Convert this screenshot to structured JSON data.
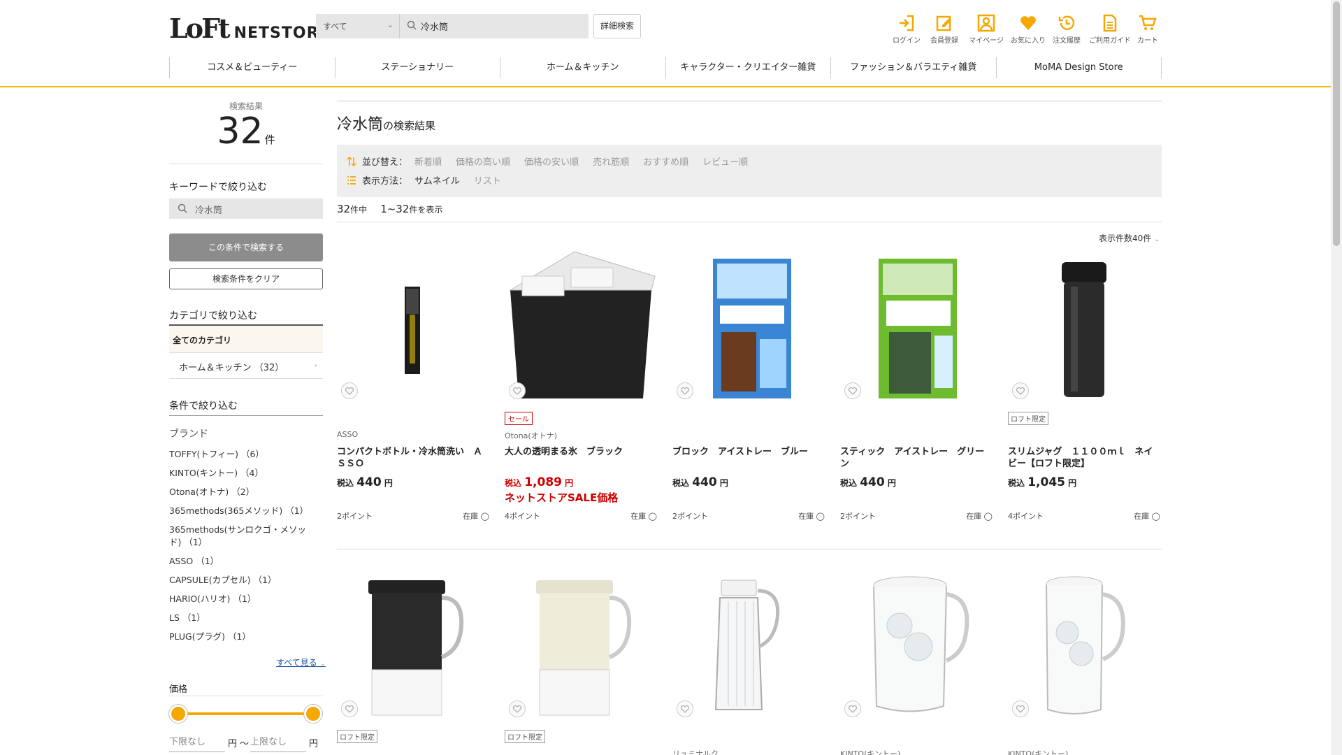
{
  "header": {
    "logo_main": "LoFt",
    "logo_sub": "NETSTORE",
    "search_scope": "すべて",
    "search_value": "冷水筒",
    "advanced_search": "詳細検索",
    "icons": [
      {
        "name": "login-icon",
        "label": "ログイン"
      },
      {
        "name": "register-icon",
        "label": "会員登録"
      },
      {
        "name": "mypage-icon",
        "label": "マイページ"
      },
      {
        "name": "favorite-icon",
        "label": "お気に入り"
      },
      {
        "name": "history-icon",
        "label": "注文履歴"
      },
      {
        "name": "guide-icon",
        "label": "ご利用ガイド"
      },
      {
        "name": "cart-icon",
        "label": "カート"
      }
    ],
    "accent_color": "#f5b800"
  },
  "nav": [
    "コスメ＆ビューティー",
    "ステーショナリー",
    "ホーム＆キッチン",
    "キャラクター・クリエイター雑貨",
    "ファッション＆バラエティ雑貨",
    "MoMA Design Store"
  ],
  "sidebar": {
    "results_label": "検索結果",
    "results_count": "32",
    "results_unit": "件",
    "keyword_title": "キーワードで絞り込む",
    "keyword_value": "冷水筒",
    "search_button": "この条件で検索する",
    "clear_button": "検索条件をクリア",
    "category_title": "カテゴリで絞り込む",
    "category_all": "全てのカテゴリ",
    "category_home": "ホーム＆キッチン （32）",
    "conditions_title": "条件で絞り込む",
    "brand_title": "ブランド",
    "brands": [
      "TOFFY(トフィー) （6）",
      "KINTO(キントー) （4）",
      "Otona(オトナ) （2）",
      "365methods(365メソッド) （1）",
      "365methods(サンロクゴ・メソッド) （1）",
      "ASSO （1）",
      "CAPSULE(カプセル) （1）",
      "HARIO(ハリオ) （1）",
      "LS （1）",
      "PLUG(プラグ) （1）"
    ],
    "see_all": "すべて見る",
    "price_title": "価格",
    "price_min_placeholder": "下限なし",
    "price_max_placeholder": "上限なし",
    "price_unit_from": "円 〜",
    "price_unit_to": "円"
  },
  "main": {
    "query": "冷水筒",
    "query_suffix": "の検索結果",
    "sort_label": "並び替え：",
    "sort_options": [
      "新着順",
      "価格の高い順",
      "価格の安い順",
      "売れ筋順",
      "おすすめ順",
      "レビュー順"
    ],
    "view_label": "表示方法：",
    "view_options": [
      "サムネイル",
      "リスト"
    ],
    "total": "32",
    "total_suffix": "件中",
    "range": "1~32",
    "range_suffix": "件を表示",
    "per_page": "表示件数40件"
  },
  "products": [
    {
      "brand": "ASSO",
      "name": "コンパクトボトル・冷水筒洗い　ＡＳＳＯ",
      "price_prefix": "税込",
      "price": "440",
      "price_unit": "円",
      "points": "2ポイント",
      "stock": "在庫 ◯"
    },
    {
      "badge": "セール",
      "brand": "Otona(オトナ)",
      "name": "大人の透明まる氷　ブラック",
      "price_prefix": "税込",
      "price": "1,089",
      "price_unit": "円",
      "sale_label": "ネットストアSALE価格",
      "points": "4ポイント",
      "stock": "在庫 ◯"
    },
    {
      "brand": "",
      "name": "ブロック　アイストレー　ブルー",
      "price_prefix": "税込",
      "price": "440",
      "price_unit": "円",
      "points": "2ポイント",
      "stock": "在庫 ◯"
    },
    {
      "brand": "",
      "name": "スティック　アイストレー　グリーン",
      "price_prefix": "税込",
      "price": "440",
      "price_unit": "円",
      "points": "2ポイント",
      "stock": "在庫 ◯"
    },
    {
      "badge": "ロフト限定",
      "brand": "",
      "name": "スリムジャグ　１１００ｍｌ　ネイビー【ロフト限定】",
      "price_prefix": "税込",
      "price": "1,045",
      "price_unit": "円",
      "points": "4ポイント",
      "stock": "在庫 ◯"
    },
    {
      "badge": "ロフト限定",
      "brand": ""
    },
    {
      "badge": "ロフト限定",
      "brand": ""
    },
    {
      "brand": "リュミナルク"
    },
    {
      "brand": "KINTO(キントー)"
    },
    {
      "brand": "KINTO(キントー)"
    }
  ]
}
